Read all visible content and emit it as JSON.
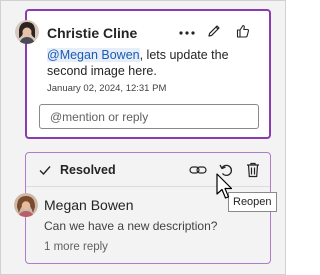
{
  "active_comment": {
    "author": "Christie Cline",
    "mention": "@Megan Bowen",
    "body": ", lets update the second image here.",
    "timestamp": "January 02, 2024, 12:31 PM",
    "reply_placeholder": "@mention or reply",
    "actions": [
      "more-options-icon",
      "edit-icon",
      "like-icon"
    ]
  },
  "resolved_thread": {
    "status_label": "Resolved",
    "author": "Megan Bowen",
    "body": "Can we have a new description?",
    "reply_count": "1 more reply",
    "actions": [
      "link-icon",
      "reopen-icon",
      "delete-icon"
    ],
    "tooltip": "Reopen"
  },
  "colors": {
    "active_border": "#8a3bb0",
    "resolved_border": "#b07cc9",
    "mention_text": "#1a5bb5"
  }
}
